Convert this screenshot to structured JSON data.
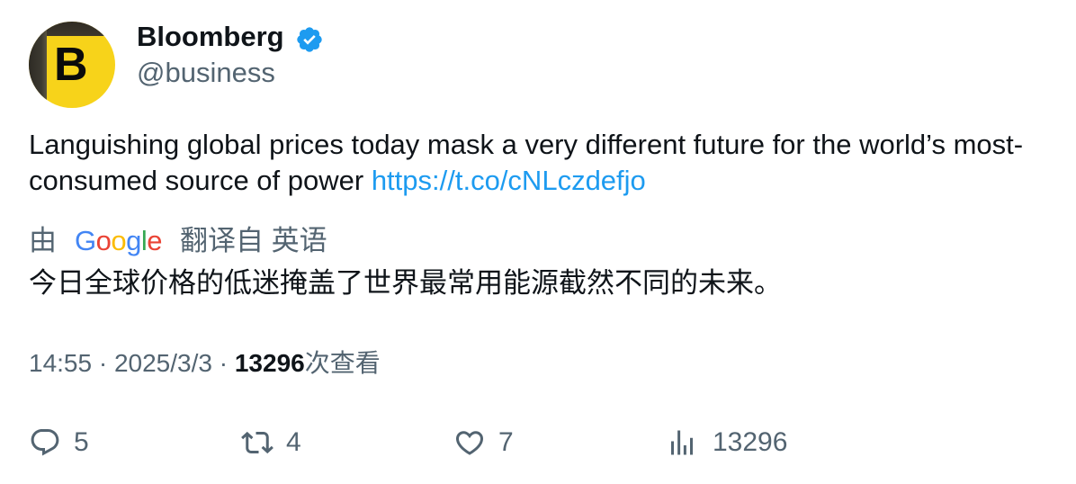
{
  "author": {
    "display_name": "Bloomberg",
    "handle": "@business",
    "avatar_letter": "B",
    "verified": true
  },
  "tweet": {
    "text": "Languishing global prices today mask a very different future for the world’s most-consumed source of power ",
    "link": "https://t.co/cNLczdefjo"
  },
  "translation": {
    "by_label": "由",
    "provider": "Google",
    "from_label": "翻译自 英语",
    "text": "今日全球价格的低迷掩盖了世界最常用能源截然不同的未来。"
  },
  "meta": {
    "time": "14:55",
    "separator": " · ",
    "date": "2025/3/3",
    "views_count": "13296",
    "views_label": "次查看"
  },
  "actions": {
    "replies": "5",
    "retweets": "4",
    "likes": "7",
    "views": "13296"
  },
  "colors": {
    "link": "#1d9bf0",
    "secondary_text": "#536471",
    "primary_text": "#0f1419",
    "verified": "#1d9bf0",
    "avatar_bg": "#f7d31a"
  },
  "icons": {
    "verified": "verified-badge-icon",
    "reply": "reply-icon",
    "retweet": "retweet-icon",
    "like": "heart-icon",
    "views": "bar-chart-icon"
  }
}
